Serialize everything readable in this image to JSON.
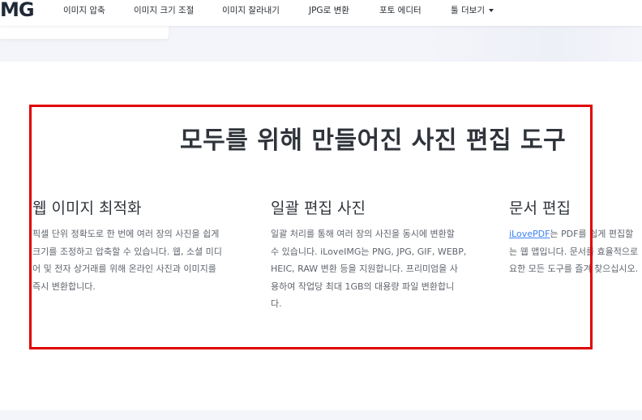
{
  "header": {
    "logo_text": "MG",
    "nav": [
      {
        "label": "이미지 압축"
      },
      {
        "label": "이미지 크기 조절"
      },
      {
        "label": "이미지 잘라내기"
      },
      {
        "label": "JPG로 변환"
      },
      {
        "label": "포토 에디터"
      },
      {
        "label": "툴 더보기"
      }
    ]
  },
  "section": {
    "title": "모두를 위해 만들어진 사진 편집 도구",
    "features": [
      {
        "title": "웹 이미지 최적화",
        "lines": [
          "픽셀 단위 정확도로 한 번에 여러 장의 사진을 쉽게",
          "크기를 조정하고 압축할 수 있습니다. 웹, 소셜 미디",
          "어 및 전자 상거래를 위해 온라인 사진과 이미지를",
          "즉시 변환합니다."
        ]
      },
      {
        "title": "일괄 편집 사진",
        "lines": [
          "일괄 처리를 통해 여러 장의 사진을 동시에 변환할",
          "수 있습니다. iLoveIMG는 PNG, JPG, GIF, WEBP,",
          "HEIC, RAW 변환 등을 지원합니다. 프리미엄을 사",
          "용하여 작업당 최대 1GB의 대용량 파일 변환합니",
          "다."
        ]
      },
      {
        "title": "문서 편집",
        "link": "iLovePDF",
        "line1_rest": "는 PDF를 쉽게 편집할",
        "lines_rest": [
          "는 웹 앱입니다. 문서를 효율적으로",
          "요한 모든 도구를 즐겨 찾으십시오."
        ]
      }
    ]
  },
  "colors": {
    "highlight_border": "#e10000",
    "link": "#3b82f6",
    "band": "#f4f5fa"
  },
  "icons": {
    "nav_more": "caret-down-icon"
  }
}
